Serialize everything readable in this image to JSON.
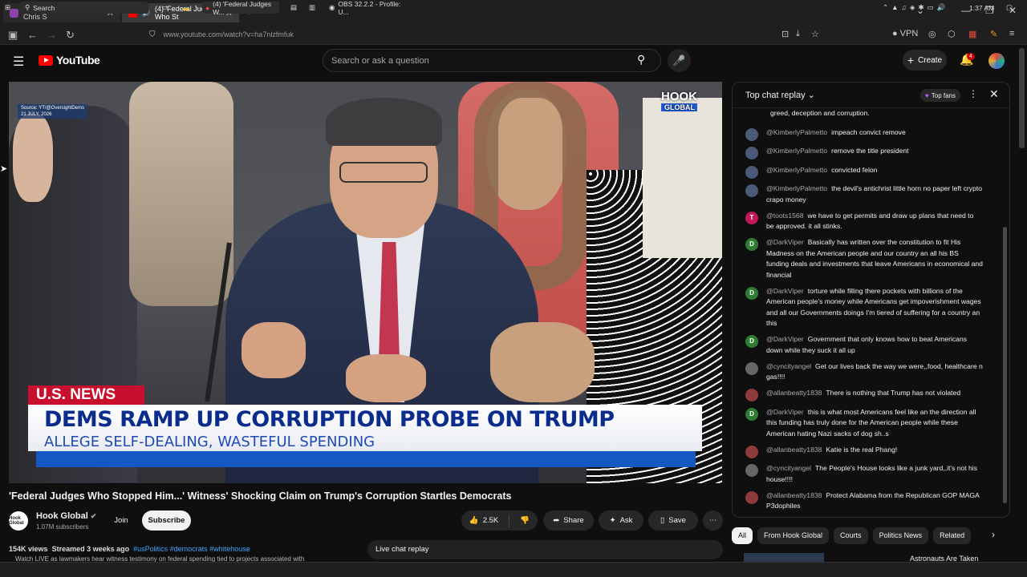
{
  "browser": {
    "tabs": [
      {
        "title": "Watch Everybody Hates Chris S",
        "favicon_color": "#8e44ad",
        "active": false
      },
      {
        "title": "(4) 'Federal Judges Who St",
        "favicon_color": "#ff0000",
        "active": true
      }
    ],
    "new_tab": "+",
    "url": "www.youtube.com/watch?v=ha7nlzfmfuk",
    "vpn_label": "VPN"
  },
  "youtube": {
    "logo_text": "YouTube",
    "search_placeholder": "Search or ask a question",
    "create_label": "Create",
    "notification_count": "4"
  },
  "video": {
    "source_badge": "Source: YT/@OversightDems",
    "date_badge": "21 JULY, 2026",
    "watermark_top": "HOOK",
    "watermark_bottom": "GLOBAL",
    "lower_third_tag": "U.S. NEWS",
    "lower_third_headline": "DEMS RAMP UP CORRUPTION PROBE ON TRUMP",
    "lower_third_sub": "ALLEGE SELF-DEALING, WASTEFUL SPENDING"
  },
  "meta": {
    "title": "'Federal Judges Who Stopped Him...' Witness' Shocking Claim on Trump's Corruption Startles Democrats",
    "channel_name": "Hook Global",
    "channel_avatar_text": "Hook Global",
    "subscribers": "1.07M subscribers",
    "join_label": "Join",
    "subscribe_label": "Subscribe",
    "likes": "2.5K",
    "share_label": "Share",
    "ask_label": "Ask",
    "save_label": "Save",
    "views": "154K views",
    "streamed": "Streamed 3 weeks ago",
    "hashtags": "#usPolitics #democrats #whitehouse",
    "desc_preview": "Watch LIVE as lawmakers hear witness testimony on federal spending tied to projects associated with"
  },
  "chat": {
    "header": "Top chat replay",
    "top_fans": "Top fans",
    "replay_button": "Live chat replay",
    "messages": [
      {
        "author": "",
        "text": "greed, deception and corruption.",
        "avatar_color": "transparent",
        "initial": ""
      },
      {
        "author": "@KimberlyPalmetto",
        "text": "impeach convict remove",
        "avatar_color": "#4a5a78",
        "initial": ""
      },
      {
        "author": "@KimberlyPalmetto",
        "text": "remove the title president",
        "avatar_color": "#4a5a78",
        "initial": ""
      },
      {
        "author": "@KimberlyPalmetto",
        "text": "convicted felon",
        "avatar_color": "#4a5a78",
        "initial": ""
      },
      {
        "author": "@KimberlyPalmetto",
        "text": "the devil's antichrist little horn no paper left crypto crapo money",
        "avatar_color": "#4a5a78",
        "initial": ""
      },
      {
        "author": "@toots1568",
        "text": "we have to get permits and draw up plans that need to be approved. it all stinks.",
        "avatar_color": "#c2185b",
        "initial": "T"
      },
      {
        "author": "@DarkViper",
        "text": "Basically has written over the constitution to fit His Madness on the American people and our country an all his BS funding deals and investments that leave Americans in economical and financial",
        "avatar_color": "#2e7d32",
        "initial": "D"
      },
      {
        "author": "@DarkViper",
        "text": "torture while filling there pockets with billions of the American people's money while Americans get impoverishment wages and all our Governments doings I'm tiered of suffering for a country an this",
        "avatar_color": "#2e7d32",
        "initial": "D"
      },
      {
        "author": "@DarkViper",
        "text": "Government that only knows how to beat Americans down while they suck it all up",
        "avatar_color": "#2e7d32",
        "initial": "D"
      },
      {
        "author": "@cyncityangel",
        "text": "Get our lives back the way we were,,food, healthcare n gas!!!!",
        "avatar_color": "#666666",
        "initial": ""
      },
      {
        "author": "@allanbeatty1838",
        "text": "There is nothing that Trump has not violated",
        "avatar_color": "#8d3a3a",
        "initial": ""
      },
      {
        "author": "@DarkViper",
        "text": "this is what most Americans feel like an the direction all this funding has truly done for the American people while these American hating Nazi sacks of dog sh..s",
        "avatar_color": "#2e7d32",
        "initial": "D"
      },
      {
        "author": "@allanbeatty1838",
        "text": "Katie is the real Phang!",
        "avatar_color": "#8d3a3a",
        "initial": ""
      },
      {
        "author": "@cyncityangel",
        "text": "The People's House looks like a junk yard,,it's not his house!!!!",
        "avatar_color": "#666666",
        "initial": ""
      },
      {
        "author": "@allanbeatty1838",
        "text": "Protect Alabama from the Republican GOP MAGA P3dophiles",
        "avatar_color": "#8d3a3a",
        "initial": ""
      },
      {
        "author": "@celestialrose-y1m",
        "text": "that ballroom is for his pedophile ass to hide when the American voters boot him out of office",
        "avatar_color": "#00897b",
        "initial": "C"
      }
    ]
  },
  "chips": [
    "All",
    "From Hook Global",
    "Courts",
    "Politics News",
    "Related"
  ],
  "related_preview_title": "Astronauts Are Taken",
  "taskbar": {
    "search": "Search",
    "task1": "(4) 'Federal Judges W...",
    "task2": "OBS 32.2.2 - Profile: U...",
    "time": "1:37 AM"
  }
}
